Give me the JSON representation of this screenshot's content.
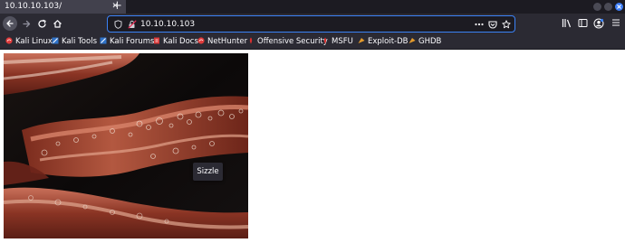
{
  "tab": {
    "title": "10.10.10.103/",
    "close_glyph": "✕",
    "new_tab_glyph": "+"
  },
  "urlbar": {
    "url": "10.10.10.103"
  },
  "bookmarks": [
    {
      "label": "Kali Linux",
      "icon": "kali-icon"
    },
    {
      "label": "Kali Tools",
      "icon": "kali-tools-icon"
    },
    {
      "label": "Kali Forums",
      "icon": "kali-forums-icon"
    },
    {
      "label": "Kali Docs",
      "icon": "kali-docs-icon"
    },
    {
      "label": "NetHunter",
      "icon": "nethunter-icon"
    },
    {
      "label": "Offensive Security",
      "icon": "offsec-icon"
    },
    {
      "label": "MSFU",
      "icon": "msfu-icon"
    },
    {
      "label": "Exploit-DB",
      "icon": "exploitdb-icon"
    },
    {
      "label": "GHDB",
      "icon": "ghdb-icon"
    }
  ],
  "page": {
    "image_tooltip": "Sizzle"
  },
  "colors": {
    "chrome_dark": "#1c1b22",
    "toolbar": "#2b2a33",
    "accent": "#3b82f6",
    "tab_active": "#42414d"
  }
}
